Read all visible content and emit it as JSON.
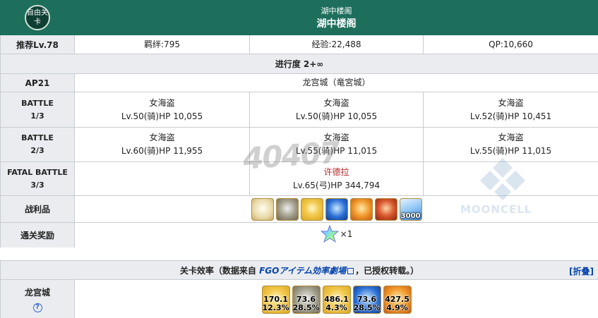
{
  "header": {
    "badge": "自由关卡",
    "subtitle": "湖中楼阁",
    "title": "湖中楼阁"
  },
  "info": {
    "level": "推荐Lv.78",
    "bond": "羁绊:795",
    "exp": "经验:22,488",
    "qp": "QP:10,660"
  },
  "progress": "进行度 2+∞",
  "ap": {
    "label": "AP21",
    "location": "龙宫城（竜宮城）"
  },
  "battles": [
    {
      "label_top": "BATTLE",
      "label_bottom": "1/3",
      "enemies": [
        {
          "name": "女海盗",
          "stats": "Lv.50(骑)HP 10,055"
        },
        {
          "name": "女海盗",
          "stats": "Lv.50(骑)HP 10,055"
        },
        {
          "name": "女海盗",
          "stats": "Lv.52(骑)HP 10,451"
        }
      ]
    },
    {
      "label_top": "BATTLE",
      "label_bottom": "2/3",
      "enemies": [
        {
          "name": "女海盗",
          "stats": "Lv.60(骑)HP 11,955"
        },
        {
          "name": "女海盗",
          "stats": "Lv.55(骑)HP 11,015"
        },
        {
          "name": "女海盗",
          "stats": "Lv.55(骑)HP 11,015"
        }
      ]
    },
    {
      "label_top": "FATAL BATTLE",
      "label_bottom": "3/3",
      "enemies": [
        {
          "name": "",
          "stats": ""
        },
        {
          "name": "许德拉",
          "stats": "Lv.65(弓)HP 344,794"
        },
        {
          "name": "",
          "stats": ""
        }
      ]
    }
  ],
  "loot": {
    "label": "战利品",
    "items": [
      {
        "icon": "urn-icon",
        "color": "#e9d9a8",
        "count": ""
      },
      {
        "icon": "ring-icon",
        "color": "#9e9a86",
        "count": ""
      },
      {
        "icon": "gold-gem-icon",
        "color": "#f2c94c",
        "count": ""
      },
      {
        "icon": "blue-orb-icon",
        "color": "#2b6fd6",
        "count": ""
      },
      {
        "icon": "orange-piece-icon",
        "color": "#f2992c",
        "count": ""
      },
      {
        "icon": "red-monument-icon",
        "color": "#d8562c",
        "count": ""
      },
      {
        "icon": "crystal-icon",
        "color": "#8ec5f5",
        "count": "3000"
      }
    ]
  },
  "clear_reward": {
    "label": "通关奖励",
    "count": "×1"
  },
  "efficiency": {
    "title_prefix": "关卡效率（数据来自",
    "source": "FGOアイテム効率劇場",
    "title_suffix": "，已授权转载。）",
    "fold": "[折叠]",
    "row_label": "龙宫城",
    "help": "?",
    "items": [
      {
        "icon": "gold-gem-icon",
        "value": "170.1",
        "rate": "12.3%"
      },
      {
        "icon": "ring-icon",
        "value": "73.6",
        "rate": "28.5%"
      },
      {
        "icon": "gold-gem-icon",
        "value": "486.1",
        "rate": "4.3%"
      },
      {
        "icon": "blue-orb-icon",
        "value": "73.6",
        "rate": "28.5%"
      },
      {
        "icon": "orange-piece-icon",
        "value": "427.5",
        "rate": "4.9%"
      }
    ]
  },
  "watermarks": {
    "site": "40407",
    "brand": "MOONCELL"
  }
}
